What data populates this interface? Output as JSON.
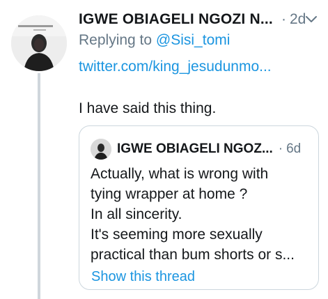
{
  "tweet": {
    "display_name": "IGWE OBIAGELI NGOZI N...",
    "separator": "·",
    "time": "2d",
    "replying_prefix": "Replying to ",
    "replying_to": "@Sisi_tomi",
    "link_text": "twitter.com/king_jesudunmo...",
    "text": "I have said this thing."
  },
  "quoted_tweet": {
    "display_name": "IGWE OBIAGELI NGOZ...",
    "separator": "·",
    "time": "6d",
    "lines": [
      "Actually, what is wrong with",
      "tying wrapper at home ?",
      "In all sincerity.",
      "It's seeming more sexually",
      "practical than bum shorts or s..."
    ],
    "show_thread_label": "Show this thread"
  },
  "colors": {
    "link_blue": "#1b95e0",
    "muted_gray": "#657786",
    "text_dark": "#14171a",
    "border": "#ccd6dd",
    "thread_line": "#cfd6dc"
  },
  "icons": {
    "menu": "chevron-down-icon"
  }
}
